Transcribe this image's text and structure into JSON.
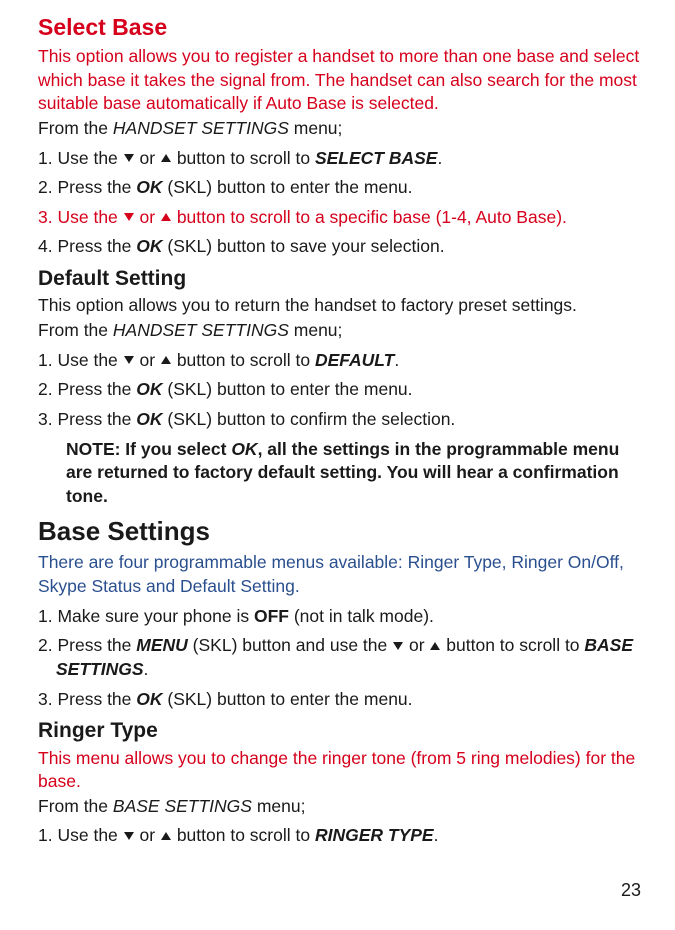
{
  "selectBase": {
    "title": "Select Base",
    "desc": "This option allows you to register a handset to more than one base and select which base it takes the signal from. The handset can also search for the most suitable base automatically if Auto Base is selected.",
    "from_prefix": "From the ",
    "from_menu": "HANDSET SETTINGS",
    "from_suffix": " menu;",
    "steps": {
      "n1": "1.",
      "s1a": " Use the ",
      "or": " or ",
      "s1b": "  button to scroll to ",
      "s1_target": "SELECT BASE",
      "dot": ".",
      "n2": "2.",
      "s2a": " Press the ",
      "s2_btn": "OK",
      "s2b": " (SKL) button to enter the menu.",
      "n3": "3.",
      "s3a": " Use the ",
      "s3b": "  button to scroll to a specific base (1-4, Auto Base).",
      "n4": "4.",
      "s4a": " Press the ",
      "s4_btn": "OK",
      "s4b": " (SKL) button to save your selection."
    }
  },
  "defaultSetting": {
    "title": "Default Setting",
    "desc": "This option allows you to return the handset to factory preset settings.",
    "from_prefix": "From the ",
    "from_menu": "HANDSET SETTINGS",
    "from_suffix": " menu;",
    "steps": {
      "n1": "1.",
      "s1a": " Use the ",
      "or": " or ",
      "s1b": "  button to scroll to ",
      "s1_target": "DEFAULT",
      "dot": ".",
      "n2": "2.",
      "s2a": " Press the ",
      "s2_btn": "OK",
      "s2b": " (SKL) button to enter the menu.",
      "n3": "3.",
      "s3a": " Press the ",
      "s3_btn": "OK",
      "s3b": " (SKL) button to confirm the selection."
    },
    "note_prefix": "NOTE: If you select ",
    "note_ok": "OK",
    "note_suffix": ", all the settings in the programmable menu are returned to factory default setting. You will hear a confirmation tone."
  },
  "baseSettings": {
    "title": "Base Settings",
    "desc": "There are four programmable menus available: Ringer Type, Ringer On/Off, Skype Status and Default Setting.",
    "steps": {
      "n1": "1.",
      "s1a": " Make sure your phone is ",
      "s1_off": "OFF",
      "s1b": " (not in talk mode).",
      "n2": "2.",
      "s2a": " Press the ",
      "s2_menu": "MENU",
      "s2b": " (SKL) button and use the ",
      "or": " or ",
      "s2c": " button to scroll to ",
      "s2_target": "BASE SETTINGS",
      "dot": ".",
      "n3": "3.",
      "s3a": " Press the ",
      "s3_btn": "OK",
      "s3b": " (SKL) button to enter the menu."
    }
  },
  "ringerType": {
    "title": "Ringer Type",
    "desc": "This menu allows you to change the ringer tone (from 5 ring melodies) for the base.",
    "from_prefix": "From the ",
    "from_menu": "BASE SETTINGS",
    "from_suffix": " menu;",
    "steps": {
      "n1": "1.",
      "s1a": " Use the ",
      "or": " or ",
      "s1b": "  button to scroll to ",
      "s1_target": "RINGER TYPE",
      "dot": "."
    }
  },
  "pageNumber": "23"
}
